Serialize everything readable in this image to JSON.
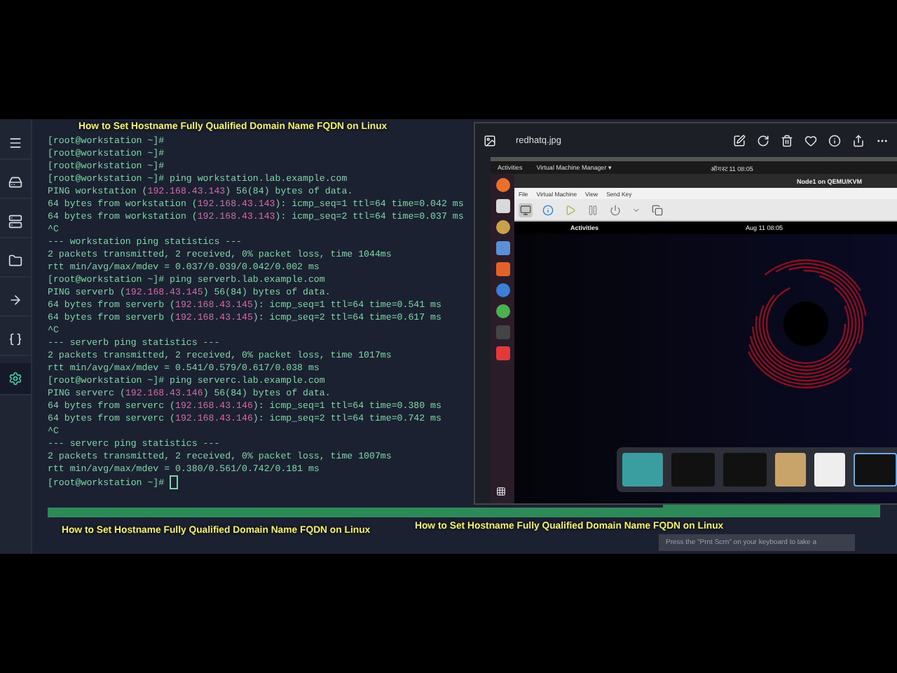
{
  "caption_top": "How to Set Hostname Fully Qualified Domain Name FQDN on Linux",
  "sidebar": {
    "items": [
      {
        "kind": "menu",
        "selected": false
      },
      {
        "kind": "disk",
        "selected": false
      },
      {
        "kind": "server",
        "selected": false
      },
      {
        "kind": "folder",
        "selected": false
      },
      {
        "kind": "arrow",
        "selected": false
      },
      {
        "kind": "braces",
        "selected": false
      },
      {
        "kind": "gear",
        "selected": true
      }
    ]
  },
  "terminal": {
    "lines": [
      [
        {
          "kind": "plain",
          "text": "[root@workstation ~]#"
        }
      ],
      [
        {
          "kind": "plain",
          "text": "[root@workstation ~]#"
        }
      ],
      [
        {
          "kind": "plain",
          "text": "[root@workstation ~]#"
        }
      ],
      [
        {
          "kind": "plain",
          "text": "[root@workstation ~]# ping workstation.lab.example.com"
        }
      ],
      [
        {
          "kind": "plain",
          "text": "PING workstation ("
        },
        {
          "kind": "ip",
          "text": "192.168.43.143"
        },
        {
          "kind": "plain",
          "text": ") 56(84) bytes of data."
        }
      ],
      [
        {
          "kind": "plain",
          "text": "64 bytes from workstation ("
        },
        {
          "kind": "ip",
          "text": "192.168.43.143"
        },
        {
          "kind": "plain",
          "text": "): icmp_seq=1 ttl=64 time=0.042 ms"
        }
      ],
      [
        {
          "kind": "plain",
          "text": "64 bytes from workstation ("
        },
        {
          "kind": "ip",
          "text": "192.168.43.143"
        },
        {
          "kind": "plain",
          "text": "): icmp_seq=2 ttl=64 time=0.037 ms"
        }
      ],
      [
        {
          "kind": "plain",
          "text": "^C"
        }
      ],
      [
        {
          "kind": "plain",
          "text": "--- workstation ping statistics ---"
        }
      ],
      [
        {
          "kind": "plain",
          "text": "2 packets transmitted, 2 received, 0% packet loss, time 1044ms"
        }
      ],
      [
        {
          "kind": "plain",
          "text": "rtt min/avg/max/mdev = 0.037/0.039/0.042/0.002 ms"
        }
      ],
      [
        {
          "kind": "plain",
          "text": "[root@workstation ~]# ping serverb.lab.example.com"
        }
      ],
      [
        {
          "kind": "plain",
          "text": "PING serverb ("
        },
        {
          "kind": "ip",
          "text": "192.168.43.145"
        },
        {
          "kind": "plain",
          "text": ") 56(84) bytes of data."
        }
      ],
      [
        {
          "kind": "plain",
          "text": "64 bytes from serverb ("
        },
        {
          "kind": "ip",
          "text": "192.168.43.145"
        },
        {
          "kind": "plain",
          "text": "): icmp_seq=1 ttl=64 time=0.541 ms"
        }
      ],
      [
        {
          "kind": "plain",
          "text": "64 bytes from serverb ("
        },
        {
          "kind": "ip",
          "text": "192.168.43.145"
        },
        {
          "kind": "plain",
          "text": "): icmp_seq=2 ttl=64 time=0.617 ms"
        }
      ],
      [
        {
          "kind": "plain",
          "text": "^C"
        }
      ],
      [
        {
          "kind": "plain",
          "text": "--- serverb ping statistics ---"
        }
      ],
      [
        {
          "kind": "plain",
          "text": "2 packets transmitted, 2 received, 0% packet loss, time 1017ms"
        }
      ],
      [
        {
          "kind": "plain",
          "text": "rtt min/avg/max/mdev = 0.541/0.579/0.617/0.038 ms"
        }
      ],
      [
        {
          "kind": "plain",
          "text": "[root@workstation ~]# ping serverc.lab.example.com"
        }
      ],
      [
        {
          "kind": "plain",
          "text": "PING serverc ("
        },
        {
          "kind": "ip",
          "text": "192.168.43.146"
        },
        {
          "kind": "plain",
          "text": ") 56(84) bytes of data."
        }
      ],
      [
        {
          "kind": "plain",
          "text": "64 bytes from serverc ("
        },
        {
          "kind": "ip",
          "text": "192.168.43.146"
        },
        {
          "kind": "plain",
          "text": "): icmp_seq=1 ttl=64 time=0.380 ms"
        }
      ],
      [
        {
          "kind": "plain",
          "text": "64 bytes from serverc ("
        },
        {
          "kind": "ip",
          "text": "192.168.43.146"
        },
        {
          "kind": "plain",
          "text": "): icmp_seq=2 ttl=64 time=0.742 ms"
        }
      ],
      [
        {
          "kind": "plain",
          "text": "^C"
        }
      ],
      [
        {
          "kind": "plain",
          "text": "--- serverc ping statistics ---"
        }
      ],
      [
        {
          "kind": "plain",
          "text": "2 packets transmitted, 2 received, 0% packet loss, time 1007ms"
        }
      ],
      [
        {
          "kind": "plain",
          "text": "rtt min/avg/max/mdev = 0.380/0.561/0.742/0.181 ms"
        }
      ],
      [
        {
          "kind": "plain",
          "text": "[root@workstation ~]# "
        },
        {
          "kind": "cursor"
        }
      ]
    ]
  },
  "caption_bottom_left": "How to Set Hostname Fully Qualified Domain Name FQDN on Linux",
  "caption_bottom_right": "How to Set Hostname Fully Qualified Domain Name FQDN on Linux",
  "viewer": {
    "file_name": "redhatq.jpg",
    "toolbar": [
      {
        "kind": "edit"
      },
      {
        "kind": "rotate"
      },
      {
        "kind": "delete"
      },
      {
        "kind": "heart"
      },
      {
        "kind": "info"
      },
      {
        "kind": "share"
      },
      {
        "kind": "more"
      }
    ],
    "image": {
      "topbar": {
        "activities": "Activities",
        "app": "Virtual Machine Manager ▾",
        "clock": "ऑगस्ट 11 08:05"
      },
      "dock": [
        {
          "kind": "firefox"
        },
        {
          "kind": "window"
        },
        {
          "kind": "disc"
        },
        {
          "kind": "document"
        },
        {
          "kind": "store"
        },
        {
          "kind": "help"
        },
        {
          "kind": "chrome"
        },
        {
          "kind": "terminal"
        },
        {
          "kind": "record"
        }
      ],
      "vm_window": {
        "title": "Node1 on QEMU/KVM",
        "menu": [
          "File",
          "Virtual Machine",
          "View",
          "Send Key"
        ],
        "guest": {
          "activities": "Activities",
          "clock": "Aug 11 08:05"
        }
      }
    },
    "filmstrip": [
      {
        "kind": "photo",
        "selected": false
      },
      {
        "kind": "screenshot",
        "selected": false
      },
      {
        "kind": "screenshot",
        "selected": false
      },
      {
        "kind": "book",
        "selected": false
      },
      {
        "kind": "document",
        "selected": false
      },
      {
        "kind": "screenshot",
        "selected": true
      }
    ]
  },
  "toast": "Press the \"Prnt Scrn\" on your keyboard to take a"
}
